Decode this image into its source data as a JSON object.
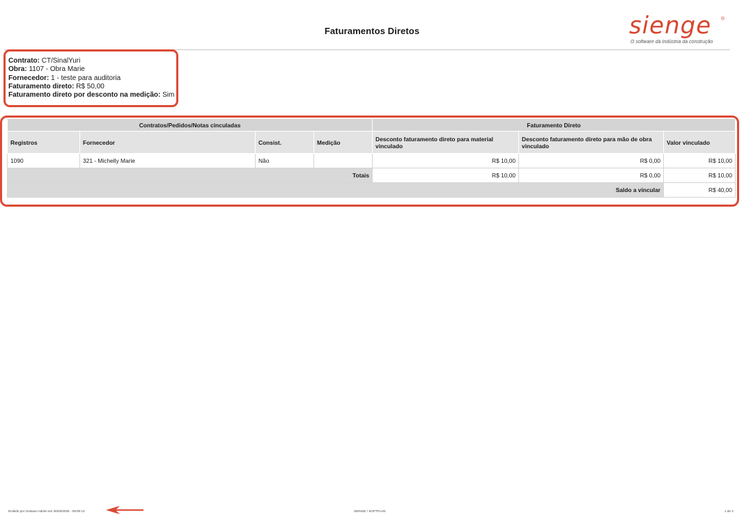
{
  "header": {
    "title": "Faturamentos Diretos",
    "logo_text": "sienge",
    "logo_tagline": "O software da Indústria da construção",
    "brand_color": "#d7462f"
  },
  "info": [
    {
      "label": "Contrato:",
      "value": "CT/SinalYuri"
    },
    {
      "label": "Obra:",
      "value": "1107 - Obra Marie"
    },
    {
      "label": "Fornecedor:",
      "value": "1 - teste para auditoria"
    },
    {
      "label": "Faturamento direto:",
      "value": "R$ 50,00"
    },
    {
      "label": "Faturamento direto por desconto na medição:",
      "value": "Sim"
    }
  ],
  "table": {
    "group_left": "Contratos/Pedidos/Notas cinculadas",
    "group_right": "Faturamento Direto",
    "columns": [
      "Registros",
      "Fornecedor",
      "Consist.",
      "Medição",
      "Desconto faturamento direto para material vinculado",
      "Desconto faturamento direto para mão de obra vinculado",
      "Valor vinculado"
    ],
    "rows": [
      {
        "registro": "1090",
        "fornecedor": "321 - Michelly Marie",
        "consist": "Não",
        "medicao": "",
        "desc_material": "R$ 10,00",
        "desc_mao_obra": "R$ 0,00",
        "valor": "R$ 10,00"
      }
    ],
    "totals": {
      "label": "Totais",
      "desc_material": "R$ 10,00",
      "desc_mao_obra": "R$ 0,00",
      "valor": "R$ 10,00"
    },
    "saldo": {
      "label": "Saldo a vincular",
      "value": "R$ 40,00"
    }
  },
  "footer": {
    "left": "Emitido por Gustavo Admin em 26/03/2025 - 09:00:13",
    "center": "SIENGE / SOFTPLAN",
    "right": "1 de 2"
  },
  "annotations": {
    "highlight_color": "#dc4a35"
  }
}
